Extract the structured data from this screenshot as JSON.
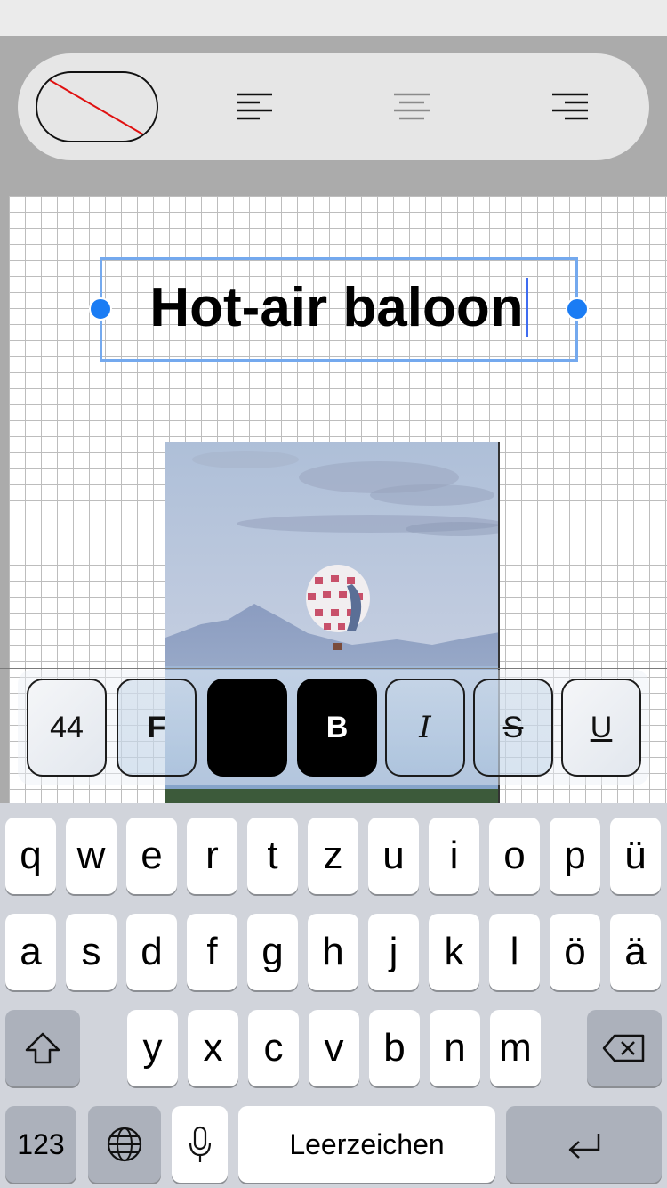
{
  "toolbar": {
    "fill_button": "no-fill",
    "align_options": [
      "align-left",
      "align-center",
      "align-right"
    ],
    "active_align": "align-center"
  },
  "canvas": {
    "title_text": "Hot-air baloon",
    "photo_subject": "hot-air balloon over mountains"
  },
  "format_bar": {
    "font_size": "44",
    "font_label": "F",
    "text_color": "#000000",
    "bold_label": "B",
    "italic_label": "I",
    "strike_label": "S",
    "underline_label": "U"
  },
  "keyboard": {
    "row1": [
      "q",
      "w",
      "e",
      "r",
      "t",
      "z",
      "u",
      "i",
      "o",
      "p",
      "ü"
    ],
    "row2": [
      "a",
      "s",
      "d",
      "f",
      "g",
      "h",
      "j",
      "k",
      "l",
      "ö",
      "ä"
    ],
    "row3": [
      "y",
      "x",
      "c",
      "v",
      "b",
      "n",
      "m"
    ],
    "numbers_label": "123",
    "space_label": "Leerzeichen",
    "icons": [
      "shift-icon",
      "backspace-icon",
      "globe-icon",
      "microphone-icon",
      "return-icon"
    ]
  }
}
